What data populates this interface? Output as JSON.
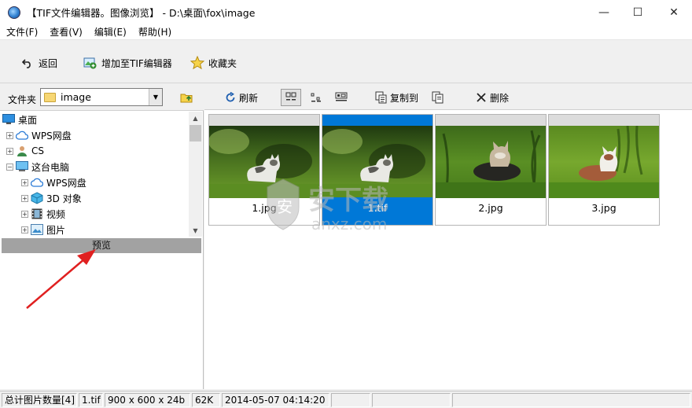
{
  "window": {
    "title": "【TIF文件编辑器。图像浏览】 - D:\\桌面\\fox\\image",
    "minimize": "—",
    "maximize": "☐",
    "close": "✕"
  },
  "menu": [
    "文件(F)",
    "查看(V)",
    "编辑(E)",
    "帮助(H)"
  ],
  "toolbar": {
    "back": "返回",
    "add_to_tif_editor": "增加至TIF编辑器",
    "favorites": "收藏夹"
  },
  "folder": {
    "label": "文件夹",
    "current": "image"
  },
  "tree": [
    {
      "label": "桌面",
      "icon": "desktop-icon",
      "level": 0,
      "expander": ""
    },
    {
      "label": "WPS网盘",
      "icon": "cloud-icon",
      "level": 1,
      "expander": "+"
    },
    {
      "label": "CS",
      "icon": "user-icon",
      "level": 1,
      "expander": "+"
    },
    {
      "label": "这台电脑",
      "icon": "computer-icon",
      "level": 1,
      "expander": "−"
    },
    {
      "label": "WPS网盘",
      "icon": "cloud-icon",
      "level": 2,
      "expander": "+"
    },
    {
      "label": "3D 对象",
      "icon": "cube-icon",
      "level": 2,
      "expander": "+"
    },
    {
      "label": "视频",
      "icon": "video-icon",
      "level": 2,
      "expander": "+"
    },
    {
      "label": "图片",
      "icon": "pictures-icon",
      "level": 2,
      "expander": "+"
    }
  ],
  "preview": {
    "label": "预览"
  },
  "toolbar2": {
    "refresh": "刷新",
    "copy_to": "复制到",
    "delete": "删除"
  },
  "thumbnails": [
    {
      "name": "1.jpg",
      "selected": false
    },
    {
      "name": "1.tif",
      "selected": true
    },
    {
      "name": "2.jpg",
      "selected": false
    },
    {
      "name": "3.jpg",
      "selected": false
    }
  ],
  "status": {
    "count": "总计图片数量[4]",
    "file": "1.tif",
    "dimensions": "900 x 600 x 24b",
    "size": "62K",
    "date": "2014-05-07 04:14:20"
  },
  "watermark": {
    "text": "安下载",
    "sub": "anxz.com"
  },
  "colors": {
    "selection": "#0078d7",
    "arrow": "#e02020"
  }
}
